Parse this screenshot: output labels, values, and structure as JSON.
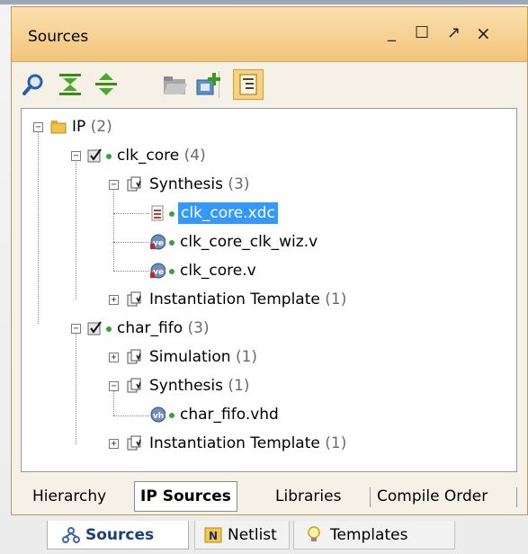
{
  "panel": {
    "title": "Sources",
    "controls": {
      "minimize": "_",
      "maximize": "☐",
      "float": "↗",
      "close": "×"
    }
  },
  "toolbar": {
    "icons": [
      "search-icon",
      "collapse-all-icon",
      "expand-all-icon",
      "folder-open-icon",
      "add-sources-icon",
      "show-hierarchy-icon"
    ]
  },
  "tree": {
    "nodes": [
      {
        "label": "IP",
        "count": "(2)",
        "icon": "folder-icon",
        "depth": 0
      },
      {
        "label": "clk_core",
        "count": "(4)",
        "icon": "ip-core-icon",
        "depth": 1
      },
      {
        "label": "Synthesis",
        "count": "(3)",
        "icon": "fileset-icon",
        "depth": 2
      },
      {
        "label": "clk_core.xdc",
        "count": "",
        "icon": "xdc-file-icon",
        "depth": 3,
        "selected": true
      },
      {
        "label": "clk_core_clk_wiz.v",
        "count": "",
        "icon": "verilog-file-icon",
        "depth": 3
      },
      {
        "label": "clk_core.v",
        "count": "",
        "icon": "verilog-file-icon",
        "depth": 3
      },
      {
        "label": "Instantiation Template",
        "count": "(1)",
        "icon": "fileset-icon",
        "depth": 2
      },
      {
        "label": "char_fifo",
        "count": "(3)",
        "icon": "ip-core-icon",
        "depth": 1
      },
      {
        "label": "Simulation",
        "count": "(1)",
        "icon": "fileset-icon",
        "depth": 2
      },
      {
        "label": "Synthesis",
        "count": "(1)",
        "icon": "fileset-icon",
        "depth": 2
      },
      {
        "label": "char_fifo.vhd",
        "count": "",
        "icon": "vhdl-file-icon",
        "depth": 3
      },
      {
        "label": "Instantiation Template",
        "count": "(1)",
        "icon": "fileset-icon",
        "depth": 2
      }
    ],
    "file_badges": {
      "verilog": "ve",
      "vhdl": "vh"
    }
  },
  "view_tabs": [
    "Hierarchy",
    "IP Sources",
    "Libraries",
    "Compile Order"
  ],
  "active_view_tab": "IP Sources",
  "bottom_tabs": [
    "Sources",
    "Netlist",
    "Templates"
  ],
  "active_bottom_tab": "Sources",
  "colors": {
    "title_bg": "#f2c57c",
    "selection": "#3399ff",
    "status_dot": "#3aa13a",
    "count_text": "#6b6b6b"
  }
}
